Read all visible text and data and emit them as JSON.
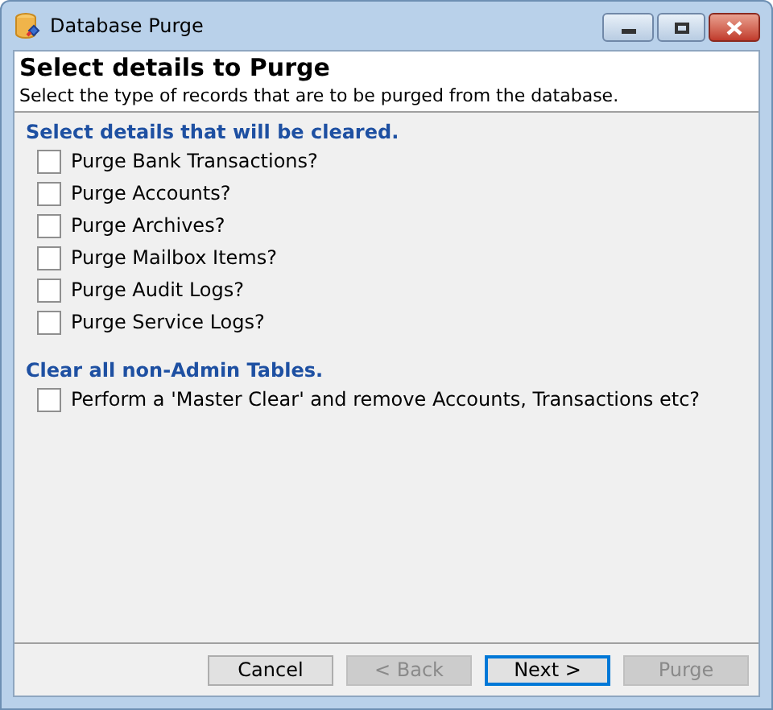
{
  "window": {
    "title": "Database Purge"
  },
  "header": {
    "title": "Select details to Purge",
    "subtitle": "Select the type of records that are to be purged from the database."
  },
  "sections": [
    {
      "heading": "Select details that will be cleared.",
      "items": [
        {
          "label": "Purge Bank Transactions?",
          "checked": false
        },
        {
          "label": "Purge Accounts?",
          "checked": false
        },
        {
          "label": "Purge Archives?",
          "checked": false
        },
        {
          "label": "Purge Mailbox Items?",
          "checked": false
        },
        {
          "label": "Purge Audit Logs?",
          "checked": false
        },
        {
          "label": "Purge Service Logs?",
          "checked": false
        }
      ]
    },
    {
      "heading": "Clear all non-Admin Tables.",
      "items": [
        {
          "label": "Perform a 'Master Clear' and remove Accounts, Transactions etc?",
          "checked": false
        }
      ]
    }
  ],
  "buttons": [
    {
      "label": "Cancel",
      "disabled": false,
      "focused": false
    },
    {
      "label": "< Back",
      "disabled": true,
      "focused": false
    },
    {
      "label": "Next >",
      "disabled": false,
      "focused": true
    },
    {
      "label": "Purge",
      "disabled": true,
      "focused": false
    }
  ]
}
